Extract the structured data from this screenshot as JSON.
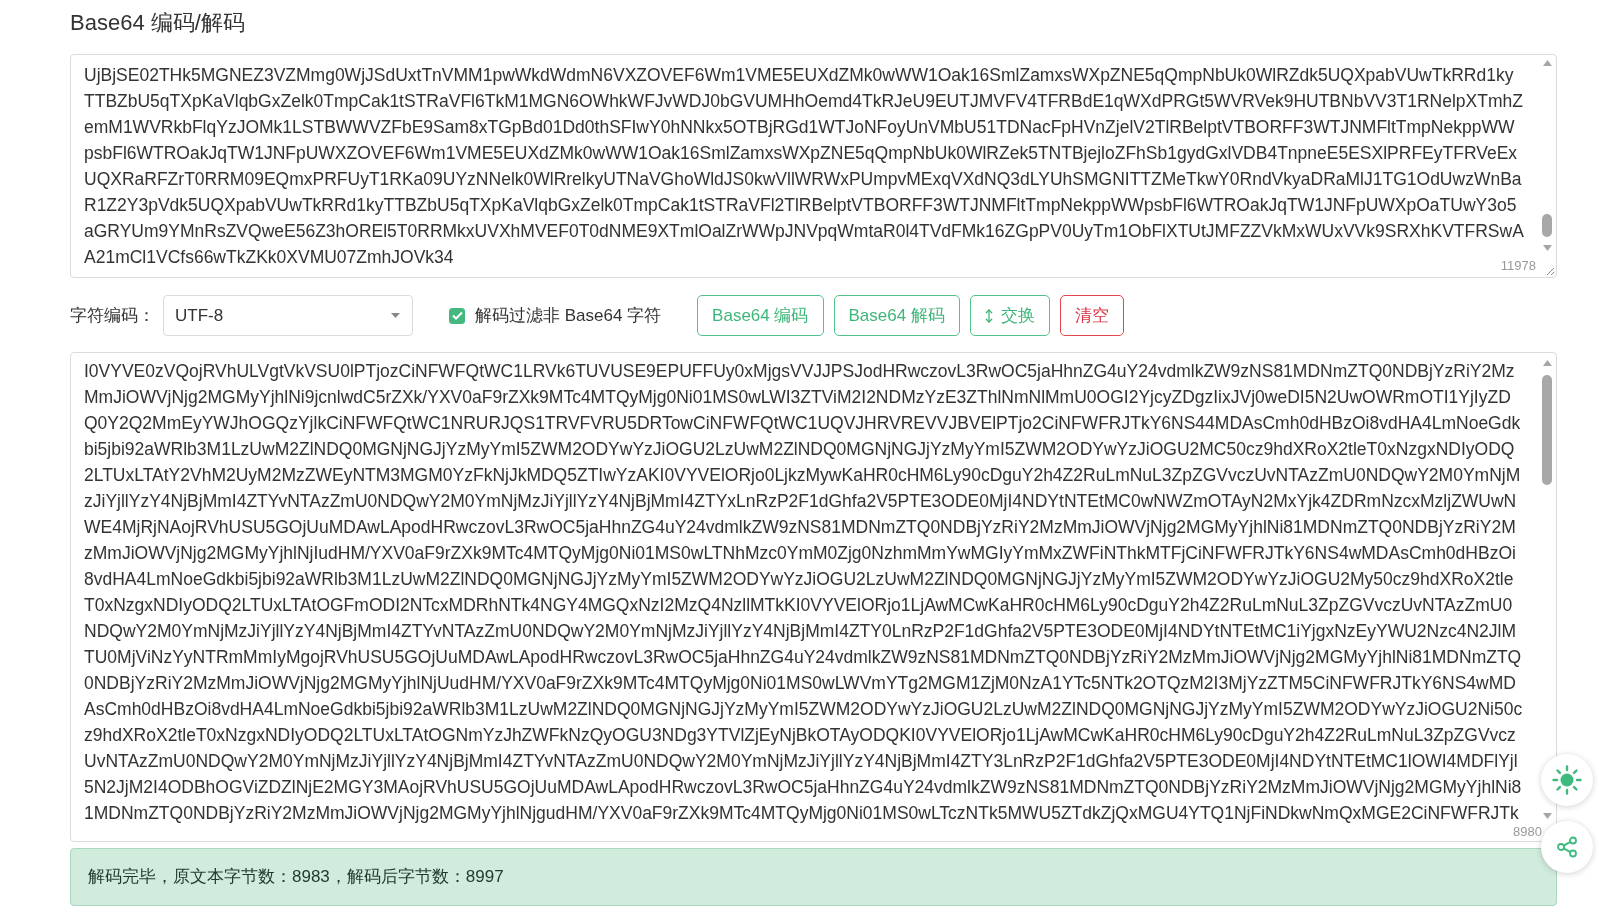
{
  "title": "Base64 编码/解码",
  "input": {
    "lines": [
      "UjBjSE02THk5MGNEZ3VZMmg0WjJSdUxtTnVMM1pwWkdWdmN6VXZOVEF6Wm1VME5EUXdZMk0wWW1Oak16SmlZamxsWXpZNE5qQmpNbUk0WlRZdk5UQXpabVUwTkRRd1ky",
      "TTBZbU5qTXpKaVlqbGxZelk0TmpCak1tSTRaVFl6TkM1MGN6OWhkWFJvWDJ0bGVUMHhOemd4TkRJeU9EUTJMVFV4TFRBdE1qWXdPRGt5WVRVek9HUTBNbVV3T1RNelpXTmhZ",
      "emM1WVRkbFlqYzJOMk1LSTBWWVZFbE9Sam8xTGpBd01Dd0thSFIwY0hNNkx5OTBjRGd1WTJoNFoyUnVMbU51TDNacFpHVnZjelV2TlRBelptVTBORFF3WTJNMFltTmpNekppWW",
      "psbFl6WTROakJqTW1JNFpUWXZOVEF6Wm1VME5EUXdZMk0wWW1Oak16SmlZamxsWXpZNE5qQmpNbUk0WlRZek5TNTBjejloZFhSb1gydGxlVDB4TnpneE5ESXlPRFEyTFRVeEx",
      "UQXRaRFZrT0RRM09EQmxPRFUyT1RKa09UYzNNelk0WlRrelkyUTNaVGhoWldJS0kwVllWRWxPUmpvMExqVXdNQ3dLYUhSMGNITTZMeTkwY0RndVkyaDRaMlJ1TG1OdUwzWnBa",
      "R1Z2Y3pVdk5UQXpabVUwTkRRd1kyTTBZbU5qTXpKaVlqbGxZelk0TmpCak1tSTRaVFl2TlRBelptVTBORFF3WTJNMFltTmpNekppWWpsbFl6WTROakJqTW1JNFpUWXpOaTUwY3o5",
      "aGRYUm9YMnRsZVQweE56Z3hOREl5T0RRMkxUVXhMVEF0T0dNME9XTmlOalZrWWpJNVpqWmtaR0l4TVdFMk16ZGpPV0UyTm1ObFlXTUtJMFZZVkMxWUxVVk9SRXhKVTFRSwA",
      "A21mCl1VCfs66wTkZKk0XVMU07ZmhJOVk34"
    ],
    "count": "11978"
  },
  "options": {
    "charset_label": "字符编码：",
    "charset": "UTF-8",
    "filter": {
      "label": "解码过滤非 Base64 字符",
      "checked": true
    }
  },
  "buttons": [
    {
      "label": "Base64 编码",
      "kind": "primary"
    },
    {
      "label": "Base64 解码",
      "kind": "primary"
    },
    {
      "label": "交换",
      "kind": "swap"
    },
    {
      "label": "清空",
      "kind": "danger"
    }
  ],
  "output": {
    "lines": [
      "I0VYVE0zVQojRVhULVgtVkVSU0lPTjozCiNFWFQtWC1LRVk6TUVUSE9EPUFFUy0xMjgsVVJJPSJodHRwczovL3RwOC5jaHhnZG4uY24vdmlkZW9zNS81MDNmZTQ0NDBjYzRiY2Mz",
      "MmJiOWVjNjg2MGMyYjhlNi9jcnlwdC5rZXk/YXV0aF9rZXk9MTc4MTQyMjg0Ni01MS0wLWI3ZTViM2I2NDMzYzE3ZThlNmNlMmU0OGI2YjcyZDgzIixJVj0weDI5N2UwOWRmOTI1YjIyZD",
      "Q0Y2Q2MmEyYWJhOGQzYjlkCiNFWFQtWC1NRURJQS1TRVFVRU5DRTowCiNFWFQtWC1UQVJHRVREVVJBVElPTjo2CiNFWFRJTkY6NS44MDAsCmh0dHBzOi8vdHA4LmNoeGdk",
      "bi5jbi92aWRlb3M1LzUwM2ZlNDQ0MGNjNGJjYzMyYmI5ZWM2ODYwYzJiOGU2LzUwM2ZlNDQ0MGNjNGJjYzMyYmI5ZWM2ODYwYzJiOGU2MC50cz9hdXRoX2tleT0xNzgxNDIyODQ",
      "2LTUxLTAtY2VhM2UyM2MzZWEyNTM3MGM0YzFkNjJkMDQ5ZTIwYzAKI0VYVElORjo0LjkzMywKaHR0cHM6Ly90cDguY2h4Z2RuLmNuL3ZpZGVvczUvNTAzZmU0NDQwY2M0YmNjM",
      "zJiYjllYzY4NjBjMmI4ZTYvNTAzZmU0NDQwY2M0YmNjMzJiYjllYzY4NjBjMmI4ZTYxLnRzP2F1dGhfa2V5PTE3ODE0MjI4NDYtNTEtMC0wNWZmOTAyN2MxYjk4ZDRmNzcxMzljZWUwN",
      "WE4MjRjNAojRVhUSU5GOjUuMDAwLApodHRwczovL3RwOC5jaHhnZG4uY24vdmlkZW9zNS81MDNmZTQ0NDBjYzRiY2MzMmJiOWVjNjg2MGMyYjhlNi81MDNmZTQ0NDBjYzRiY2M",
      "zMmJiOWVjNjg2MGMyYjhlNjIudHM/YXV0aF9rZXk9MTc4MTQyMjg0Ni01MS0wLTNhMzc0YmM0Zjg0NzhmMmYwMGIyYmMxZWFiNThkMTFjCiNFWFRJTkY6NS4wMDAsCmh0dHBzOi",
      "8vdHA4LmNoeGdkbi5jbi92aWRlb3M1LzUwM2ZlNDQ0MGNjNGJjYzMyYmI5ZWM2ODYwYzJiOGU2LzUwM2ZlNDQ0MGNjNGJjYzMyYmI5ZWM2ODYwYzJiOGU2My50cz9hdXRoX2tle",
      "T0xNzgxNDIyODQ2LTUxLTAtOGFmODI2NTcxMDRhNTk4NGY4MGQxNzI2MzQ4NzllMTkKI0VYVElORjo1LjAwMCwKaHR0cHM6Ly90cDguY2h4Z2RuLmNuL3ZpZGVvczUvNTAzZmU0",
      "NDQwY2M0YmNjMzJiYjllYzY4NjBjMmI4ZTYvNTAzZmU0NDQwY2M0YmNjMzJiYjllYzY4NjBjMmI4ZTY0LnRzP2F1dGhfa2V5PTE3ODE0MjI4NDYtNTEtMC1iYjgxNzEyYWU2Nzc4N2JlM",
      "TU0MjViNzYyNTRmMmIyMgojRVhUSU5GOjUuMDAwLApodHRwczovL3RwOC5jaHhnZG4uY24vdmlkZW9zNS81MDNmZTQ0NDBjYzRiY2MzMmJiOWVjNjg2MGMyYjhlNi81MDNmZTQ",
      "0NDBjYzRiY2MzMmJiOWVjNjg2MGMyYjhlNjUudHM/YXV0aF9rZXk9MTc4MTQyMjg0Ni01MS0wLWVmYTg2MGM1ZjM0NzA1YTc5NTk2OTQzM2I3MjYzZTM5CiNFWFRJTkY6NS4wMD",
      "AsCmh0dHBzOi8vdHA4LmNoeGdkbi5jbi92aWRlb3M1LzUwM2ZlNDQ0MGNjNGJjYzMyYmI5ZWM2ODYwYzJiOGU2LzUwM2ZlNDQ0MGNjNGJjYzMyYmI5ZWM2ODYwYzJiOGU2Ni50c",
      "z9hdXRoX2tleT0xNzgxNDIyODQ2LTUxLTAtOGNmYzJhZWFkNzQyOGU3NDg3YTVlZjEyNjBkOTAyODQKI0VYVElORjo1LjAwMCwKaHR0cHM6Ly90cDguY2h4Z2RuLmNuL3ZpZGVvcz",
      "UvNTAzZmU0NDQwY2M0YmNjMzJiYjllYzY4NjBjMmI4ZTYvNTAzZmU0NDQwY2M0YmNjMzJiYjllYzY4NjBjMmI4ZTY3LnRzP2F1dGhfa2V5PTE3ODE0MjI4NDYtNTEtMC1lOWI4MDFlYjl",
      "5N2JjM2I4ODBhOGViZDZlNjE2MGY3MAojRVhUSU5GOjUuMDAwLApodHRwczovL3RwOC5jaHhnZG4uY24vdmlkZW9zNS81MDNmZTQ0NDBjYzRiY2MzMmJiOWVjNjg2MGMyYjhlNi8",
      "1MDNmZTQ0NDBjYzRiY2MzMmJiOWVjNjg2MGMyYjhlNjgudHM/YXV0aF9rZXk9MTc4MTQyMjg0Ni01MS0wLTczNTk5MWU5ZTdkZjQxMGU4YTQ1NjFiNDkwNmQxMGE2CiNFWFRJTk"
    ],
    "count": "8980"
  },
  "status": {
    "message": "解码完毕，原文本字节数：8983，解码后字节数：8997",
    "kind": "success"
  }
}
